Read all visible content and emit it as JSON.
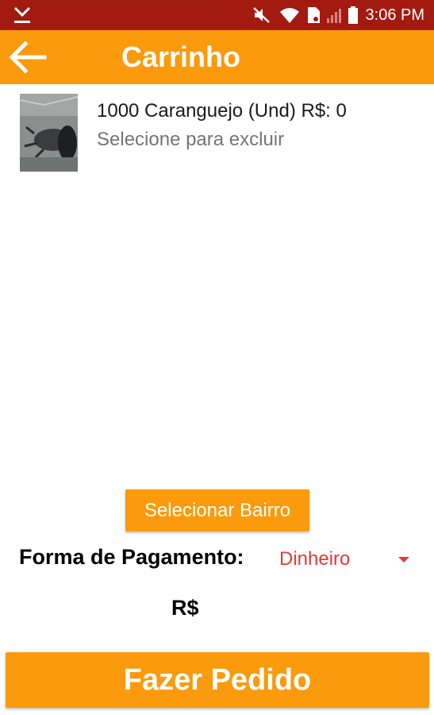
{
  "status_bar": {
    "time": "3:06 PM",
    "icons": [
      "download-icon",
      "mute-icon",
      "wifi-icon",
      "sim-card-icon",
      "signal-icon",
      "battery-icon"
    ]
  },
  "app_bar": {
    "title": "Carrinho",
    "back_icon": "arrow-left-icon"
  },
  "cart": {
    "items": [
      {
        "title": "1000 Caranguejo (Und) R$: 0",
        "subtitle": "Selecione para excluir"
      }
    ]
  },
  "bairro_button": {
    "label": "Selecionar Bairro"
  },
  "payment": {
    "label": "Forma de Pagamento:",
    "selected": "Dinheiro"
  },
  "total": {
    "label": "R$"
  },
  "order_button": {
    "label": "Fazer Pedido"
  },
  "colors": {
    "status_bar": "#a31a11",
    "accent": "#fb9a0c",
    "select_text": "#e53935"
  }
}
